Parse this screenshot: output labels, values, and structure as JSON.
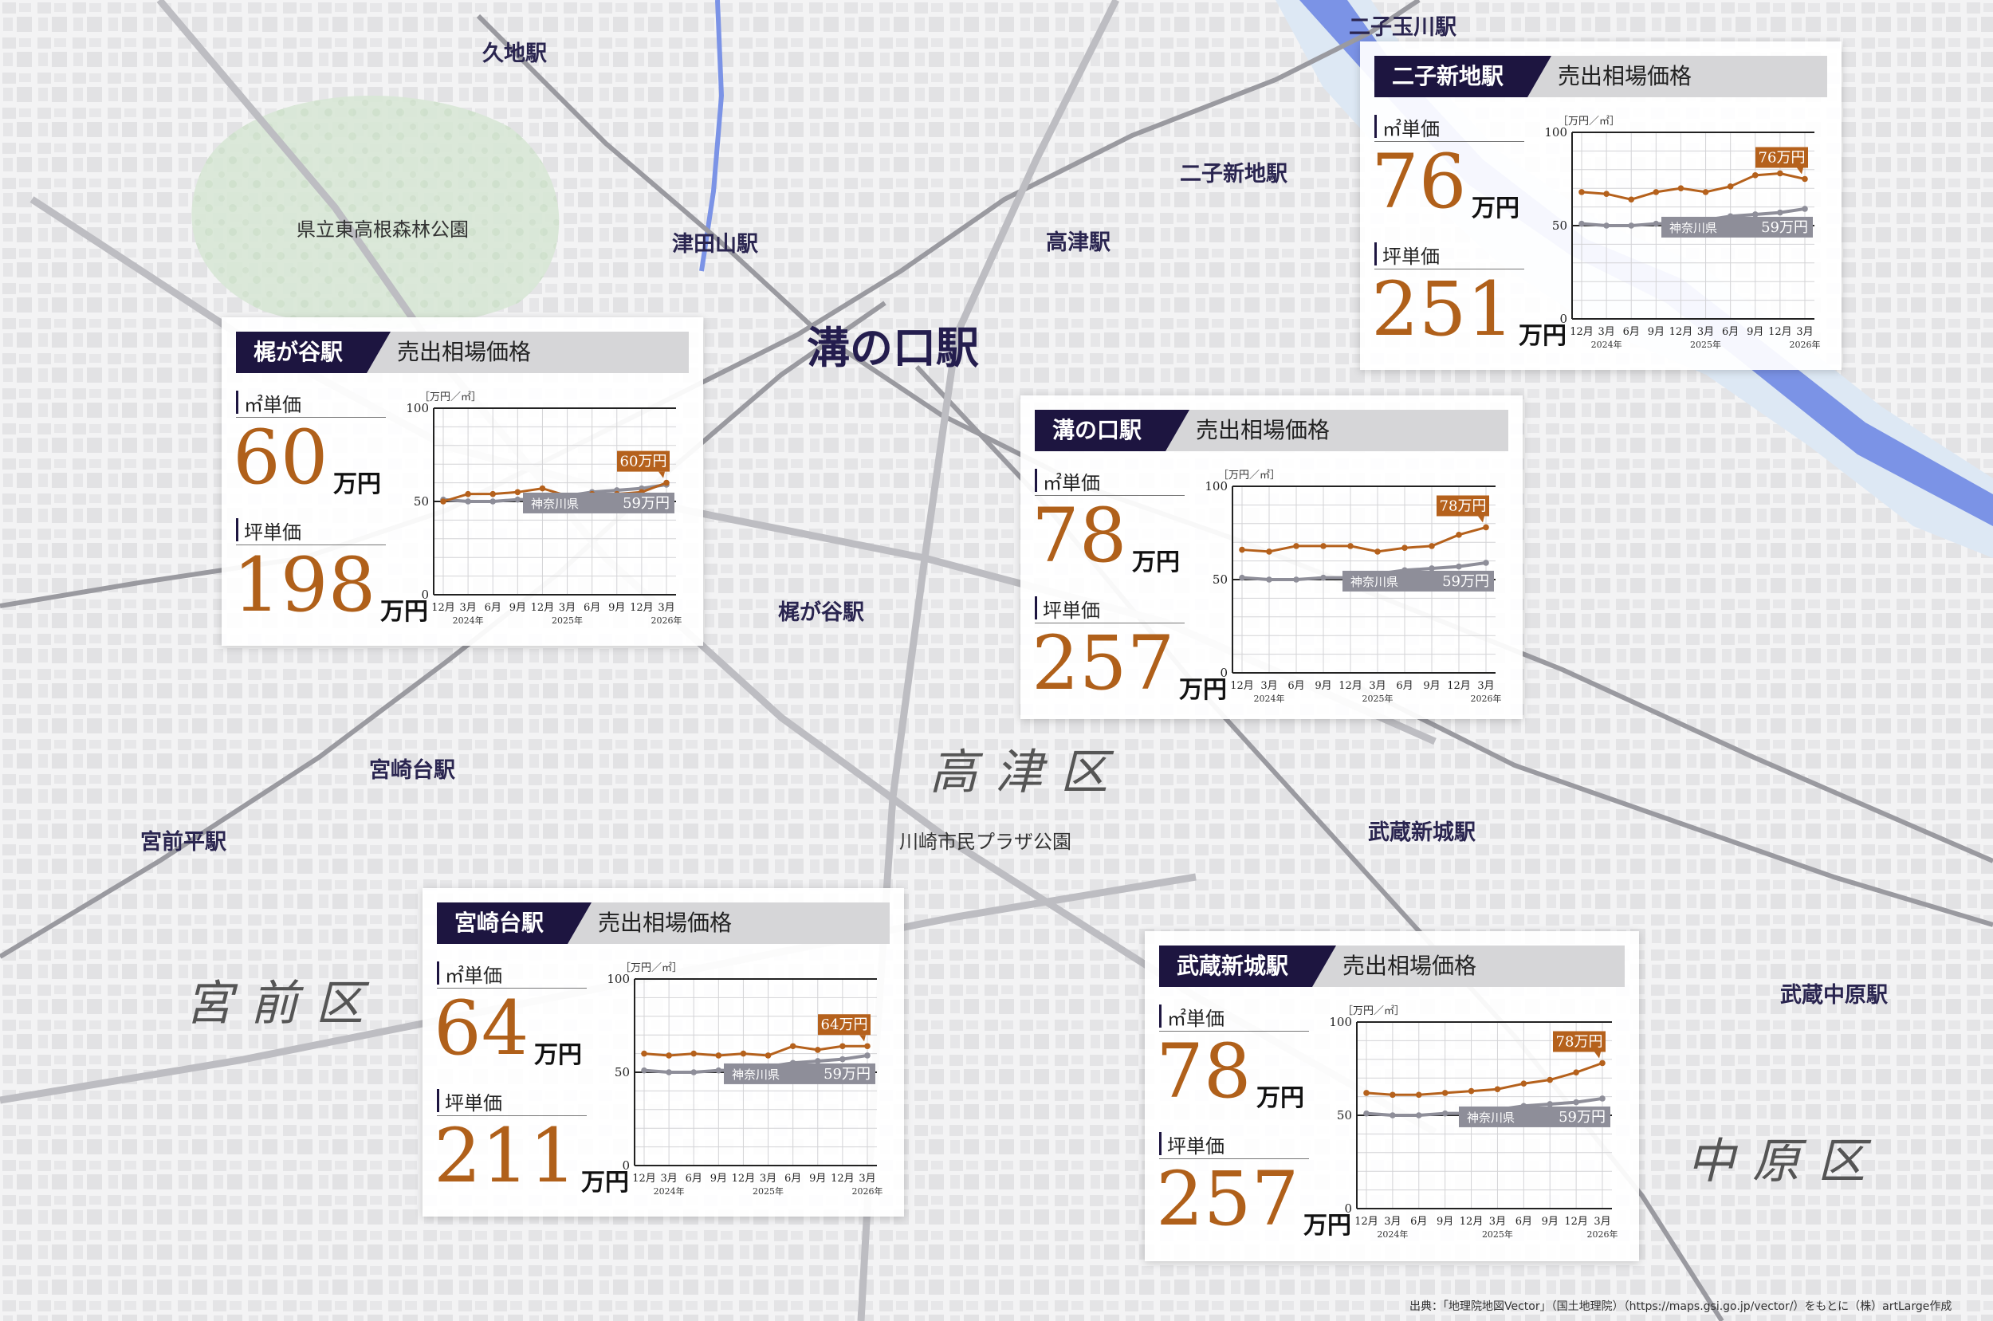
{
  "colors": {
    "local": "#b5611c",
    "pref": "#8e8e99",
    "header": "#1d1540",
    "river": "#7b93e6"
  },
  "map_labels": {
    "futako_tamagawa": "二子玉川駅",
    "kuji": "久地駅",
    "park_higashitakane": "県立東高根森林公園",
    "tsudayama": "津田山駅",
    "takatsu": "高津駅",
    "futako_shinchi": "二子新地駅",
    "mizonokuchi": "溝の口駅",
    "kajigaya": "梶が谷駅",
    "miyazakidai": "宮崎台駅",
    "miyamaedaira": "宮前平駅",
    "ward_takatsu": "高津区",
    "park_plaza": "川崎市民プラザ公園",
    "musashi_shinjo": "武蔵新城駅",
    "ward_miyamae": "宮前区",
    "musashi_nakahara": "武蔵中原駅",
    "ward_nakahara": "中原区"
  },
  "source": "出典：「地理院地図Vector」（国土地理院）（https://maps.gsi.go.jp/vector/）をもとに（株）artLarge作成",
  "common": {
    "title": "売出相場価格",
    "m2_label": "㎡単価",
    "tsubo_label": "坪単価",
    "unit": "万円",
    "axis_unit": "［万円／㎡］"
  },
  "chart_data": [
    {
      "type": "line",
      "station": "二子新地駅",
      "m2_price": "76",
      "tsubo_price": "251",
      "x": [
        "12月",
        "3月",
        "6月",
        "9月",
        "12月",
        "3月",
        "6月",
        "9月",
        "12月",
        "3月"
      ],
      "year_labels": [
        "2024年",
        "2025年",
        "2026年"
      ],
      "ylim": [
        0,
        100
      ],
      "yticks": [
        0,
        50,
        100
      ],
      "series": [
        {
          "name": "二子新地駅",
          "values": [
            68,
            67,
            64,
            68,
            70,
            68,
            71,
            77,
            78,
            75
          ],
          "end_label": "76万円"
        },
        {
          "name": "神奈川県",
          "values": [
            51,
            50,
            50,
            51,
            51,
            53,
            55,
            56,
            57,
            59
          ],
          "end_label": "59万円"
        }
      ]
    },
    {
      "type": "line",
      "station": "梶が谷駅",
      "m2_price": "60",
      "tsubo_price": "198",
      "x": [
        "12月",
        "3月",
        "6月",
        "9月",
        "12月",
        "3月",
        "6月",
        "9月",
        "12月",
        "3月"
      ],
      "year_labels": [
        "2024年",
        "2025年",
        "2026年"
      ],
      "ylim": [
        0,
        100
      ],
      "yticks": [
        0,
        50,
        100
      ],
      "series": [
        {
          "name": "梶が谷駅",
          "values": [
            50,
            54,
            54,
            55,
            57,
            53,
            54,
            54,
            55,
            60
          ],
          "end_label": "60万円"
        },
        {
          "name": "神奈川県",
          "values": [
            51,
            50,
            50,
            51,
            51,
            53,
            55,
            56,
            57,
            59
          ],
          "end_label": "59万円"
        }
      ]
    },
    {
      "type": "line",
      "station": "溝の口駅",
      "m2_price": "78",
      "tsubo_price": "257",
      "x": [
        "12月",
        "3月",
        "6月",
        "9月",
        "12月",
        "3月",
        "6月",
        "9月",
        "12月",
        "3月"
      ],
      "year_labels": [
        "2024年",
        "2025年",
        "2026年"
      ],
      "ylim": [
        0,
        100
      ],
      "yticks": [
        0,
        50,
        100
      ],
      "series": [
        {
          "name": "溝の口駅",
          "values": [
            66,
            65,
            68,
            68,
            68,
            65,
            67,
            68,
            74,
            78
          ],
          "end_label": "78万円"
        },
        {
          "name": "神奈川県",
          "values": [
            51,
            50,
            50,
            51,
            51,
            53,
            55,
            56,
            57,
            59
          ],
          "end_label": "59万円"
        }
      ]
    },
    {
      "type": "line",
      "station": "宮崎台駅",
      "m2_price": "64",
      "tsubo_price": "211",
      "x": [
        "12月",
        "3月",
        "6月",
        "9月",
        "12月",
        "3月",
        "6月",
        "9月",
        "12月",
        "3月"
      ],
      "year_labels": [
        "2024年",
        "2025年",
        "2026年"
      ],
      "ylim": [
        0,
        100
      ],
      "yticks": [
        0,
        50,
        100
      ],
      "series": [
        {
          "name": "宮崎台駅",
          "values": [
            60,
            59,
            60,
            59,
            60,
            59,
            64,
            62,
            64,
            64
          ],
          "end_label": "64万円"
        },
        {
          "name": "神奈川県",
          "values": [
            51,
            50,
            50,
            51,
            51,
            53,
            55,
            56,
            57,
            59
          ],
          "end_label": "59万円"
        }
      ]
    },
    {
      "type": "line",
      "station": "武蔵新城駅",
      "m2_price": "78",
      "tsubo_price": "257",
      "x": [
        "12月",
        "3月",
        "6月",
        "9月",
        "12月",
        "3月",
        "6月",
        "9月",
        "12月",
        "3月"
      ],
      "year_labels": [
        "2024年",
        "2025年",
        "2026年"
      ],
      "ylim": [
        0,
        100
      ],
      "yticks": [
        0,
        50,
        100
      ],
      "series": [
        {
          "name": "武蔵新城駅",
          "values": [
            62,
            61,
            61,
            62,
            63,
            64,
            67,
            69,
            73,
            78
          ],
          "end_label": "78万円"
        },
        {
          "name": "神奈川県",
          "values": [
            51,
            50,
            50,
            51,
            51,
            53,
            55,
            56,
            57,
            59
          ],
          "end_label": "59万円"
        }
      ]
    }
  ]
}
